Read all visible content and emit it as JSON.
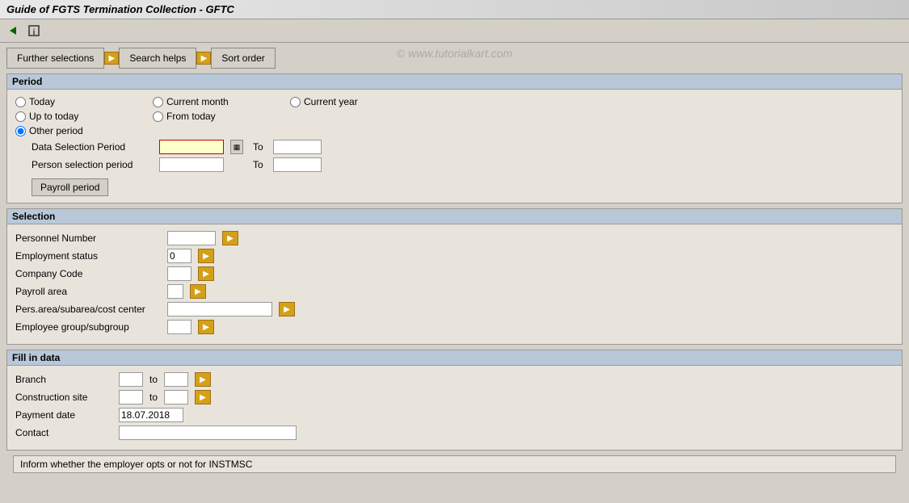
{
  "titleBar": {
    "text": "Guide of FGTS Termination Collection - GFTC"
  },
  "watermark": "© www.tutorialkart.com",
  "tabs": {
    "furtherSelections": "Further selections",
    "searchHelps": "Search helps",
    "sortOrder": "Sort order"
  },
  "period": {
    "sectionTitle": "Period",
    "radios": {
      "today": "Today",
      "upToToday": "Up to today",
      "currentMonth": "Current month",
      "fromToday": "From today",
      "currentYear": "Current year",
      "otherPeriod": "Other period"
    },
    "dataSelectionPeriod": "Data Selection Period",
    "personSelectionPeriod": "Person selection period",
    "to": "To",
    "payrollPeriodBtn": "Payroll period",
    "dataSelectionValue": "",
    "dataSelectionTo": "",
    "personSelectionValue": "",
    "personSelectionTo": ""
  },
  "selection": {
    "sectionTitle": "Selection",
    "fields": [
      {
        "label": "Personnel Number",
        "value": "",
        "width": 60
      },
      {
        "label": "Employment status",
        "value": "0",
        "width": 30
      },
      {
        "label": "Company Code",
        "value": "",
        "width": 30
      },
      {
        "label": "Payroll area",
        "value": "",
        "width": 20
      },
      {
        "label": "Pers.area/subarea/cost center",
        "value": "",
        "width": 130
      },
      {
        "label": "Employee group/subgroup",
        "value": "",
        "width": 30
      }
    ]
  },
  "fillInData": {
    "sectionTitle": "Fill in data",
    "fields": [
      {
        "label": "Branch",
        "value": "",
        "hasTo": true,
        "toValue": ""
      },
      {
        "label": "Construction site",
        "value": "",
        "hasTo": true,
        "toValue": ""
      },
      {
        "label": "Payment date",
        "value": "18.07.2018",
        "hasTo": false
      },
      {
        "label": "Contact",
        "value": "",
        "wide": true,
        "hasTo": false
      }
    ],
    "to": "to"
  },
  "statusBar": {
    "text": "Inform whether the employer opts or not for INSTMSC"
  },
  "icons": {
    "arrow": "➔",
    "arrowRight": "▶",
    "calendar": "▦",
    "checkmark": "✓"
  }
}
